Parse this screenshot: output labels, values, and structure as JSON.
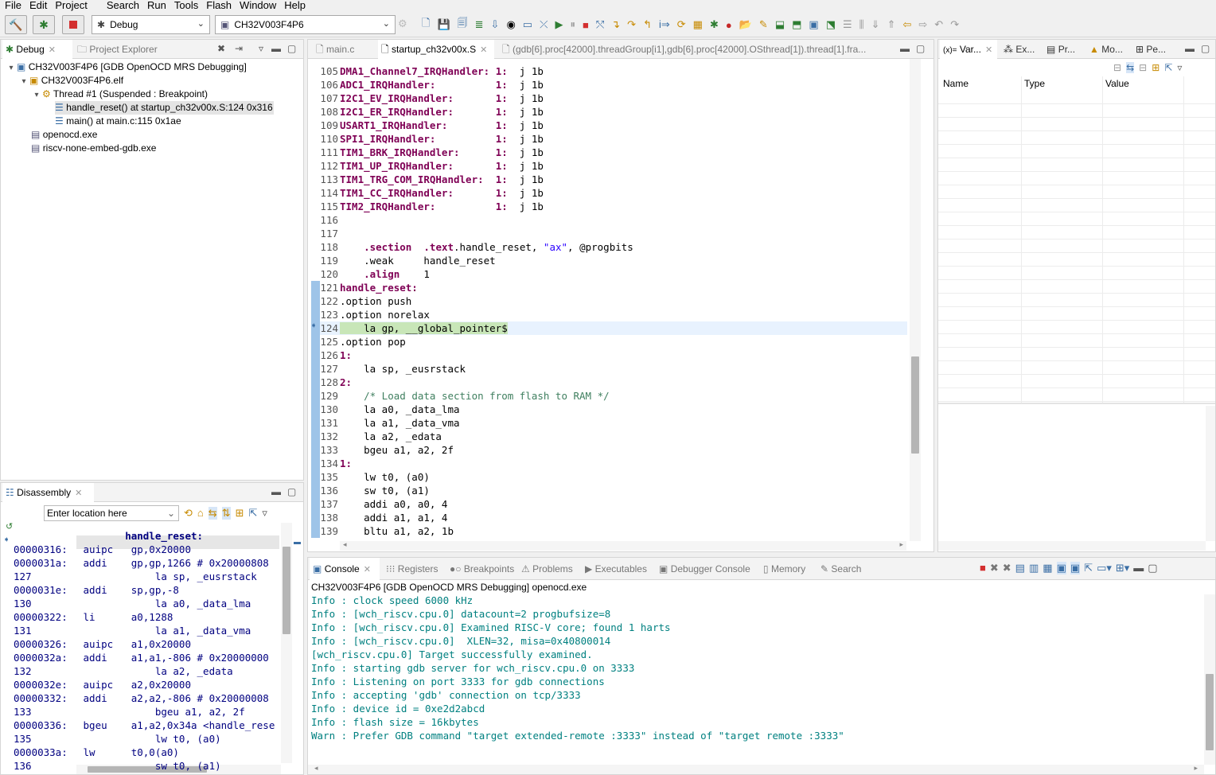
{
  "menu": [
    "File",
    "Edit",
    "Project",
    "Search",
    "Run",
    "Tools",
    "Flash",
    "Window",
    "Help"
  ],
  "toolbar": {
    "mode_combo": "Debug",
    "target_combo": "CH32V003F4P6"
  },
  "debug_panel": {
    "tabs": [
      "Debug",
      "Project Explorer"
    ],
    "tree": [
      "CH32V003F4P6 [GDB OpenOCD MRS Debugging]",
      "CH32V003F4P6.elf",
      "Thread #1 (Suspended : Breakpoint)",
      "handle_reset() at startup_ch32v00x.S:124 0x316",
      "main() at main.c:115 0x1ae",
      "openocd.exe",
      "riscv-none-embed-gdb.exe"
    ]
  },
  "editor": {
    "tabs": [
      "main.c",
      "startup_ch32v00x.S",
      "(gdb[6].proc[42000].threadGroup[i1],gdb[6].proc[42000].OSthread[1]).thread[1].fra..."
    ],
    "lines": [
      {
        "n": "105",
        "label": "DMA1_Channel7_IRQHandler:",
        "rest": "1:  j 1b"
      },
      {
        "n": "106",
        "label": "ADC1_IRQHandler:",
        "rest": "1:  j 1b"
      },
      {
        "n": "107",
        "label": "I2C1_EV_IRQHandler:",
        "rest": "1:  j 1b"
      },
      {
        "n": "108",
        "label": "I2C1_ER_IRQHandler:",
        "rest": "1:  j 1b"
      },
      {
        "n": "109",
        "label": "USART1_IRQHandler:",
        "rest": "1:  j 1b"
      },
      {
        "n": "110",
        "label": "SPI1_IRQHandler:",
        "rest": "1:  j 1b"
      },
      {
        "n": "111",
        "label": "TIM1_BRK_IRQHandler:",
        "rest": "1:  j 1b"
      },
      {
        "n": "112",
        "label": "TIM1_UP_IRQHandler:",
        "rest": "1:  j 1b"
      },
      {
        "n": "113",
        "label": "TIM1_TRG_COM_IRQHandler:",
        "rest": "1:  j 1b"
      },
      {
        "n": "114",
        "label": "TIM1_CC_IRQHandler:",
        "rest": "1:  j 1b"
      },
      {
        "n": "115",
        "label": "TIM2_IRQHandler:",
        "rest": "1:  j 1b"
      },
      {
        "n": "116",
        "text": ""
      },
      {
        "n": "117",
        "text": ""
      },
      {
        "n": "118",
        "text": "    .section  .text.handle_reset, \"ax\", @progbits"
      },
      {
        "n": "119",
        "text": "    .weak     handle_reset"
      },
      {
        "n": "120",
        "text": "    .align    1"
      },
      {
        "n": "121",
        "text": "handle_reset:"
      },
      {
        "n": "122",
        "text": ".option push"
      },
      {
        "n": "123",
        "text": ".option norelax"
      },
      {
        "n": "124",
        "text": "    la gp, __global_pointer$"
      },
      {
        "n": "125",
        "text": ".option pop"
      },
      {
        "n": "126",
        "text": "1:"
      },
      {
        "n": "127",
        "text": "    la sp, _eusrstack"
      },
      {
        "n": "128",
        "text": "2:"
      },
      {
        "n": "129",
        "text": "    /* Load data section from flash to RAM */"
      },
      {
        "n": "130",
        "text": "    la a0, _data_lma"
      },
      {
        "n": "131",
        "text": "    la a1, _data_vma"
      },
      {
        "n": "132",
        "text": "    la a2, _edata"
      },
      {
        "n": "133",
        "text": "    bgeu a1, a2, 2f"
      },
      {
        "n": "134",
        "text": "1:"
      },
      {
        "n": "135",
        "text": "    lw t0, (a0)"
      },
      {
        "n": "136",
        "text": "    sw t0, (a1)"
      },
      {
        "n": "137",
        "text": "    addi a0, a0, 4"
      },
      {
        "n": "138",
        "text": "    addi a1, a1, 4"
      },
      {
        "n": "139",
        "text": "    bltu a1, a2, 1b"
      }
    ]
  },
  "variables_panel": {
    "tabs": [
      "Var...",
      "Ex...",
      "Pr...",
      "Mo...",
      "Pe..."
    ],
    "columns": [
      "Name",
      "Type",
      "Value"
    ]
  },
  "disassembly": {
    "tab": "Disassembly",
    "location_placeholder": "Enter location here",
    "rows": [
      {
        "a": "",
        "t": "         handle_reset:"
      },
      {
        "a": "00000316:",
        "t": "  auipc   gp,0x20000"
      },
      {
        "a": "0000031a:",
        "t": "  addi    gp,gp,1266 # 0x20000808"
      },
      {
        "a": "127",
        "t": "              la sp, _eusrstack"
      },
      {
        "a": "0000031e:",
        "t": "  addi    sp,gp,-8"
      },
      {
        "a": "130",
        "t": "              la a0, _data_lma"
      },
      {
        "a": "00000322:",
        "t": "  li      a0,1288"
      },
      {
        "a": "131",
        "t": "              la a1, _data_vma"
      },
      {
        "a": "00000326:",
        "t": "  auipc   a1,0x20000"
      },
      {
        "a": "0000032a:",
        "t": "  addi    a1,a1,-806 # 0x20000000"
      },
      {
        "a": "132",
        "t": "              la a2, _edata"
      },
      {
        "a": "0000032e:",
        "t": "  auipc   a2,0x20000"
      },
      {
        "a": "00000332:",
        "t": "  addi    a2,a2,-806 # 0x20000008"
      },
      {
        "a": "133",
        "t": "              bgeu a1, a2, 2f"
      },
      {
        "a": "00000336:",
        "t": "  bgeu    a1,a2,0x34a <handle_rese"
      },
      {
        "a": "135",
        "t": "              lw t0, (a0)"
      },
      {
        "a": "0000033a:",
        "t": "  lw      t0,0(a0)"
      },
      {
        "a": "136",
        "t": "              sw t0, (a1)"
      }
    ]
  },
  "console": {
    "tabs": [
      "Console",
      "Registers",
      "Breakpoints",
      "Problems",
      "Executables",
      "Debugger Console",
      "Memory",
      "Search"
    ],
    "header": "CH32V003F4P6 [GDB OpenOCD MRS Debugging] openocd.exe",
    "lines": [
      {
        "c": "teal",
        "t": "Info : clock speed 6000 kHz"
      },
      {
        "c": "teal",
        "t": "Info : [wch_riscv.cpu.0] datacount=2 progbufsize=8"
      },
      {
        "c": "teal",
        "t": "Info : [wch_riscv.cpu.0] Examined RISC-V core; found 1 harts"
      },
      {
        "c": "teal",
        "t": "Info : [wch_riscv.cpu.0]  XLEN=32, misa=0x40800014"
      },
      {
        "c": "teal",
        "t": "[wch_riscv.cpu.0] Target successfully examined."
      },
      {
        "c": "teal",
        "t": "Info : starting gdb server for wch_riscv.cpu.0 on 3333"
      },
      {
        "c": "teal",
        "t": "Info : Listening on port 3333 for gdb connections"
      },
      {
        "c": "teal",
        "t": "Info : accepting 'gdb' connection on tcp/3333"
      },
      {
        "c": "teal",
        "t": "Info : device id = 0xe2d2abcd"
      },
      {
        "c": "teal",
        "t": "Info : flash size = 16kbytes"
      },
      {
        "c": "teal",
        "t": "Warn : Prefer GDB command \"target extended-remote :3333\" instead of \"target remote :3333\""
      }
    ]
  }
}
